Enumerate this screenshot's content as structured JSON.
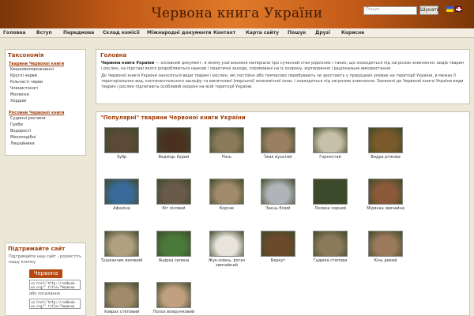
{
  "header": {
    "title": "Червона книга України",
    "search_placeholder": "Пошук",
    "search_button": "Шукати"
  },
  "menu": [
    "Головна",
    "Вступ",
    "Передмова",
    "Склад комісії",
    "Міжнародні документи",
    "Контакт",
    "Карта сайту",
    "Пошук",
    "Друзі",
    "Корисне"
  ],
  "sidebar": {
    "taxonomy_title": "Таксономія",
    "animals_title": "Тварини Червоної книги",
    "animals": [
      "Кишковопорожнинні",
      "Круглі черви",
      "Кільчасті черви",
      "Членистоногі",
      "Молюски",
      "Хордові"
    ],
    "plants_title": "Рослини Червоної книги",
    "plants": [
      "Судинні рослини",
      "Гриби",
      "Водорості",
      "Мохоподібні",
      "Лишайники"
    ],
    "support_title": "Підтримайте сайт",
    "support_text": "Підтримайте наш сайт - розмістіть нашу кнопку",
    "support_button": "Червона",
    "code_1": "<a href=\"http://redbook-ua.org/\" title=\"Червона книга",
    "code_2": "або посилання",
    "code_3": "<a href=\"http://redbook-ua.org/\" title=\"Червона книга"
  },
  "home": {
    "title": "Головна",
    "bold": "Червона книга України",
    "p1": " — основний документ, в якому узагальнено матеріали про сучасний стан рідкісних і таких, що знаходяться під загрозою зникнення, видів тварин і рослин, на підставі якого розробляються наукові і практичні заходи, спрямовані на їх охорону, відтворення і раціональне використання.",
    "p2": "До Червоної книги України заносяться види тварин і рослин, які постійно або тимчасово перебувають чи зростають у природних умовах на території України, в межах її територіальних вод, континентального шельфу та виняткової (морської) економічної зони, і знаходяться під загрозою зникнення. Занесені до Червоної книги України види тварин і рослин підлягають особливій охороні на всій території України."
  },
  "popular": {
    "title": "\"Популярні\" тварини Червоної книги України",
    "items": [
      {
        "name": "Зубр",
        "color": "#5a4a36"
      },
      {
        "name": "Ведмідь бурий",
        "color": "#4a3020"
      },
      {
        "name": "Рись",
        "color": "#8a7a5a"
      },
      {
        "name": "Їжак вухатий",
        "color": "#9a8060"
      },
      {
        "name": "Горностай",
        "color": "#c8c0a8"
      },
      {
        "name": "Видра річкова",
        "color": "#7a5a2a"
      },
      {
        "name": "Афаліна",
        "color": "#3a6a9a"
      },
      {
        "name": "Кіт лісовий",
        "color": "#6a5a4a"
      },
      {
        "name": "Корсак",
        "color": "#a08a6a"
      },
      {
        "name": "Заєць білий",
        "color": "#b0b4b8"
      },
      {
        "name": "Лелека чорний",
        "color": "#3a4a2a"
      },
      {
        "name": "Мідянка звичайна",
        "color": "#8a5a3a"
      },
      {
        "name": "Тушканчик великий",
        "color": "#b0a080"
      },
      {
        "name": "Ящірка зелена",
        "color": "#4a7a3a"
      },
      {
        "name": "Жук-олень, рогач звичайний",
        "color": "#e8e4dc"
      },
      {
        "name": "Беркут",
        "color": "#6a4a2a"
      },
      {
        "name": "Гадюка степова",
        "color": "#8a7a5a"
      },
      {
        "name": "Кінь дикий",
        "color": "#9a7a5a"
      },
      {
        "name": "Ховрах степовий",
        "color": "#a08a6a"
      },
      {
        "name": "Полоз візерунковий",
        "color": "#c0a080"
      }
    ]
  }
}
